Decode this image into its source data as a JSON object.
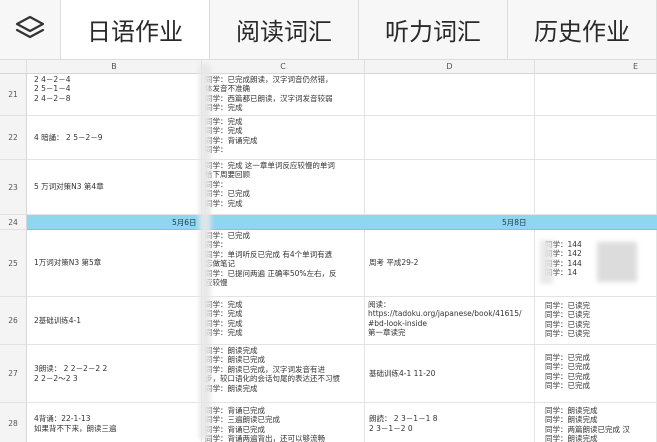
{
  "tabs": [
    {
      "label": "日语作业",
      "active": true
    },
    {
      "label": "阅读词汇",
      "active": false
    },
    {
      "label": "听力词汇",
      "active": false
    },
    {
      "label": "历史作业",
      "active": false
    }
  ],
  "icons": {
    "menu": "layers-icon"
  },
  "columns": [
    "B",
    "C",
    "D",
    "E"
  ],
  "rows": [
    {
      "num": "21",
      "b": "2 4－2－4\n2 5－1－4\n2 4－2－8",
      "c": "同学：已完成朗读，汉字词音仍然错，\n体发音不准确\n同学：西篇都已朗读，汉字词发音较弱\n同学：完成",
      "d": "",
      "e": ""
    },
    {
      "num": "22",
      "b": "4 暗誦： 2 5－2－9",
      "c": "同学：完成\n同学：完成\n同学：背诵完成\n同学：",
      "d": "",
      "e": ""
    },
    {
      "num": "23",
      "b": "5 万词对策N3 第4章",
      "c": "同学：完成 这一章单词反应较慢的单词\n给下周要回顾\n同学：\n同学：已完成\n同学：完成",
      "d": "",
      "e": ""
    },
    {
      "num": "24",
      "band": true,
      "left_date": "5月6日",
      "right_date": "5月8日"
    },
    {
      "num": "25",
      "b": "1万词对策N3 第5章",
      "c": "同学：已完成\n同学：\n同学：单词听反已完成 有4个单词有遗\n忘做笔记\n同学：已提问两遍 正确率50%左右，反\n应较慢",
      "d": "周考 平成29-2",
      "e": "同学：144\n同学：142\n同学：144\n同学：14"
    },
    {
      "num": "26",
      "b": "2基础训练4-1",
      "c": "同学：完成\n同学：完成\n同学：完成\n同学：完成",
      "d": "阅读：\nhttps://tadoku.org/japanese/book/41615/\n#bd-look-inside\n第一章读完",
      "e": "同学：已读完\n同学：已读完\n同学：已读完\n同学：已读完"
    },
    {
      "num": "27",
      "b": "3朗读： 2 2－2－2 2\n2 2－2～2 3",
      "c": "同学：朗读完成\n同学：朗读已完成\n同学：朗读已完成，汉字词发音有进\n步，较口语化的会话句尾的表达还不习惯\n同学：朗读完成",
      "d": "基础训练4-1  11-20",
      "e": "同学：已完成\n同学：已完成\n同学：已完成\n同学：已完成"
    },
    {
      "num": "28",
      "b": "4背诵：22-1-13\n如果背不下来，朗读三遍",
      "c": "同学：背诵已完成\n同学：三遍朗读已完成\n同学：背诵已完成\n同学：背诵两遍背出，还可以够流畅",
      "d": "朗読： 2 3－1－1 8\n2 3－1－2 0",
      "e": "同学：朗读完成\n同学：朗读完成\n同学：两篇朗读已完成 汉\n同学：朗读完成"
    }
  ]
}
